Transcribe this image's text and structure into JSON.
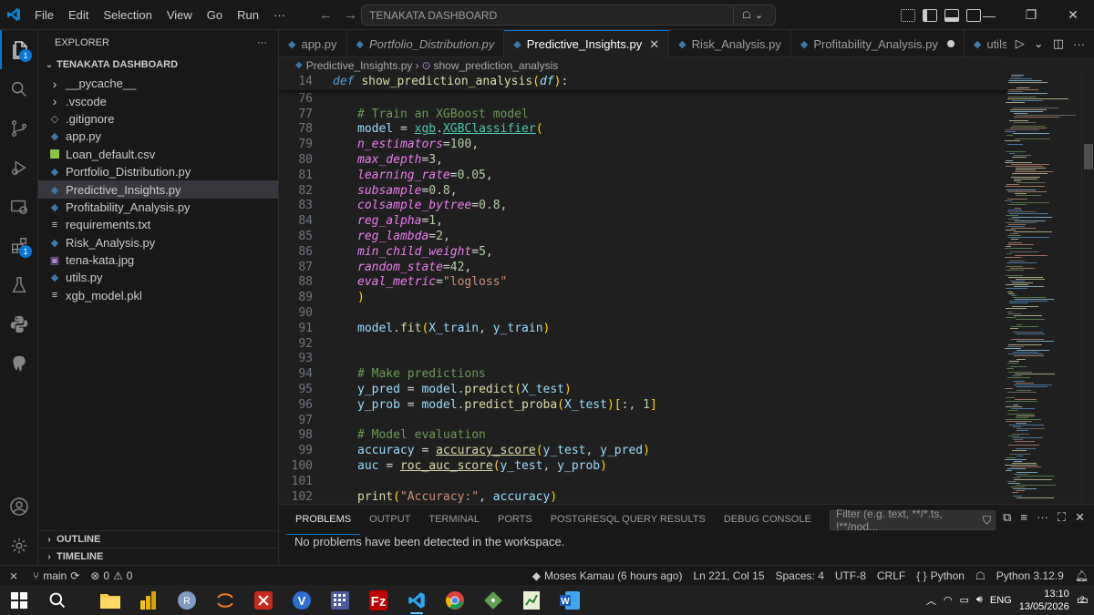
{
  "menu": [
    "File",
    "Edit",
    "Selection",
    "View",
    "Go",
    "Run",
    "···"
  ],
  "command_center": "TENAKATA DASHBOARD",
  "explorer": {
    "title": "EXPLORER",
    "more": "···",
    "root": "TENAKATA DASHBOARD",
    "items": [
      {
        "label": "__pycache__",
        "type": "folder"
      },
      {
        "label": ".vscode",
        "type": "folder"
      },
      {
        "label": ".gitignore",
        "type": "git"
      },
      {
        "label": "app.py",
        "type": "py"
      },
      {
        "label": "Loan_default.csv",
        "type": "csv"
      },
      {
        "label": "Portfolio_Distribution.py",
        "type": "py"
      },
      {
        "label": "Predictive_Insights.py",
        "type": "py",
        "selected": true
      },
      {
        "label": "Profitability_Analysis.py",
        "type": "py"
      },
      {
        "label": "requirements.txt",
        "type": "txt"
      },
      {
        "label": "Risk_Analysis.py",
        "type": "py"
      },
      {
        "label": "tena-kata.jpg",
        "type": "img"
      },
      {
        "label": "utils.py",
        "type": "py"
      },
      {
        "label": "xgb_model.pkl",
        "type": "txt"
      }
    ],
    "outline": "OUTLINE",
    "timeline": "TIMELINE"
  },
  "activity_badges": {
    "explorer": "1",
    "extensions": "1"
  },
  "tabs": [
    {
      "label": "app.py"
    },
    {
      "label": "Portfolio_Distribution.py",
      "italic": true
    },
    {
      "label": "Predictive_Insights.py",
      "active": true
    },
    {
      "label": "Risk_Analysis.py"
    },
    {
      "label": "Profitability_Analysis.py",
      "dirty": true
    },
    {
      "label": "utils.py"
    }
  ],
  "breadcrumb": {
    "file": "Predictive_Insights.py",
    "symbol": "show_prediction_analysis"
  },
  "sticky": {
    "line": "14",
    "text": "def show_prediction_analysis(df):"
  },
  "code_lines": [
    {
      "n": "76",
      "html": ""
    },
    {
      "n": "77",
      "html": "<span class=\"com\"># Train an XGBoost model</span>"
    },
    {
      "n": "78",
      "html": "<span class=\"var\">model</span> <span class=\"op\">=</span> <span class=\"mod\">xgb</span>.<span class=\"mod\">XGBClassifier</span><span class=\"br1\">(</span>"
    },
    {
      "n": "79",
      "html": "<span class=\"argp\">n_estimators</span><span class=\"op\">=</span><span class=\"num\">100</span>,"
    },
    {
      "n": "80",
      "html": "<span class=\"argp\">max_depth</span><span class=\"op\">=</span><span class=\"num\">3</span>,"
    },
    {
      "n": "81",
      "html": "<span class=\"argp\">learning_rate</span><span class=\"op\">=</span><span class=\"num\">0.05</span>,"
    },
    {
      "n": "82",
      "html": "<span class=\"argp\">subsample</span><span class=\"op\">=</span><span class=\"num\">0.8</span>,"
    },
    {
      "n": "83",
      "html": "<span class=\"argp\">colsample_bytree</span><span class=\"op\">=</span><span class=\"num\">0.8</span>,"
    },
    {
      "n": "84",
      "html": "<span class=\"argp\">reg_alpha</span><span class=\"op\">=</span><span class=\"num\">1</span>,"
    },
    {
      "n": "85",
      "html": "<span class=\"argp\">reg_lambda</span><span class=\"op\">=</span><span class=\"num\">2</span>,"
    },
    {
      "n": "86",
      "html": "<span class=\"argp\">min_child_weight</span><span class=\"op\">=</span><span class=\"num\">5</span>,"
    },
    {
      "n": "87",
      "html": "<span class=\"argp\">random_state</span><span class=\"op\">=</span><span class=\"num\">42</span>,"
    },
    {
      "n": "88",
      "html": "<span class=\"argp\">eval_metric</span><span class=\"op\">=</span><span class=\"str\">\"logloss\"</span>"
    },
    {
      "n": "89",
      "html": "<span class=\"br1\">)</span>"
    },
    {
      "n": "90",
      "html": ""
    },
    {
      "n": "91",
      "html": "<span class=\"var\">model</span>.<span class=\"fn\">fit</span><span class=\"br1\">(</span><span class=\"var\">X_train</span>, <span class=\"var\">y_train</span><span class=\"br1\">)</span>"
    },
    {
      "n": "92",
      "html": ""
    },
    {
      "n": "93",
      "html": ""
    },
    {
      "n": "94",
      "html": "<span class=\"com\"># Make predictions</span>"
    },
    {
      "n": "95",
      "html": "<span class=\"var\">y_pred</span> <span class=\"op\">=</span> <span class=\"var\">model</span>.<span class=\"fn\">predict</span><span class=\"br1\">(</span><span class=\"var\">X_test</span><span class=\"br1\">)</span>"
    },
    {
      "n": "96",
      "html": "<span class=\"var\">y_prob</span> <span class=\"op\">=</span> <span class=\"var\">model</span>.<span class=\"fn\">predict_proba</span><span class=\"br1\">(</span><span class=\"var\">X_test</span><span class=\"br1\">)</span><span class=\"br1\">[</span>:, <span class=\"num\">1</span><span class=\"br1\">]</span>"
    },
    {
      "n": "97",
      "html": ""
    },
    {
      "n": "98",
      "html": "<span class=\"com\"># Model evaluation</span>"
    },
    {
      "n": "99",
      "html": "<span class=\"var\">accuracy</span> <span class=\"op\">=</span> <span class=\"fn-u\">accuracy_score</span><span class=\"br1\">(</span><span class=\"var\">y_test</span>, <span class=\"var\">y_pred</span><span class=\"br1\">)</span>"
    },
    {
      "n": "100",
      "html": "<span class=\"var\">auc</span> <span class=\"op\">=</span> <span class=\"fn-u\">roc_auc_score</span><span class=\"br1\">(</span><span class=\"var\">y_test</span>, <span class=\"var\">y_prob</span><span class=\"br1\">)</span>"
    },
    {
      "n": "101",
      "html": ""
    },
    {
      "n": "102",
      "html": "<span class=\"fn\">print</span><span class=\"br1\">(</span><span class=\"str\">\"Accuracy:\"</span>, <span class=\"var\">accuracy</span><span class=\"br1\">)</span>"
    }
  ],
  "panel": {
    "tabs": [
      "PROBLEMS",
      "OUTPUT",
      "TERMINAL",
      "PORTS",
      "POSTGRESQL QUERY RESULTS",
      "DEBUG CONSOLE"
    ],
    "filter_placeholder": "Filter (e.g. text, **/*.ts, !**/nod...",
    "message": "No problems have been detected in the workspace."
  },
  "status": {
    "branch": "main",
    "errors": "0",
    "warnings": "0",
    "blame": "Moses Kamau (6 hours ago)",
    "position": "Ln 221, Col 15",
    "spaces": "Spaces: 4",
    "encoding": "UTF-8",
    "eol": "CRLF",
    "language": "Python",
    "interpreter": "Python 3.12.9"
  },
  "taskbar": {
    "lang": "ENG",
    "time": "13:10",
    "date": "13/05/2026",
    "notifications": "2"
  },
  "colors": {
    "accent": "#0078d4",
    "bg": "#1f1f1f",
    "sidebar": "#181818"
  }
}
